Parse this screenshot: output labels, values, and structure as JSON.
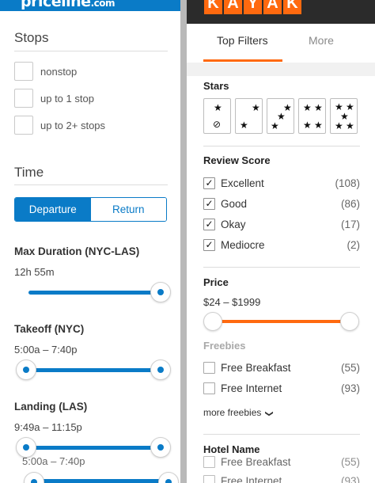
{
  "priceline": {
    "brand": "priceline",
    "brand_suffix": ".com",
    "stops": {
      "title": "Stops",
      "options": [
        "nonstop",
        "up to 1 stop",
        "up to 2+ stops"
      ]
    },
    "time": {
      "title": "Time",
      "toggle": {
        "departure": "Departure",
        "return": "Return"
      },
      "max_duration": {
        "label": "Max Duration (NYC-LAS)",
        "value": "12h 55m"
      },
      "takeoff": {
        "label": "Takeoff (NYC)",
        "value": "5:00a  –  7:40p"
      },
      "landing": {
        "label": "Landing (LAS)",
        "value": "9:49a  –  11:15p"
      },
      "ghost_value": "5:00a  –  7:40p"
    }
  },
  "kayak": {
    "logo_letters": [
      "K",
      "A",
      "Y",
      "A",
      "K"
    ],
    "tabs": {
      "top_filters": "Top Filters",
      "more": "More"
    },
    "stars": {
      "title": "Stars"
    },
    "review_score": {
      "title": "Review Score",
      "options": [
        {
          "label": "Excellent",
          "count": "(108)"
        },
        {
          "label": "Good",
          "count": "(86)"
        },
        {
          "label": "Okay",
          "count": "(17)"
        },
        {
          "label": "Mediocre",
          "count": "(2)"
        }
      ]
    },
    "price": {
      "title": "Price",
      "range": "$24 – $1999"
    },
    "freebies": {
      "title": "Freebies",
      "options": [
        {
          "label": "Free Breakfast",
          "count": "(55)"
        },
        {
          "label": "Free Internet",
          "count": "(93)"
        }
      ],
      "more_link": "more freebies"
    },
    "hotel_name": {
      "title": "Hotel Name"
    }
  },
  "colors": {
    "priceline_blue": "#0a7bc7",
    "kayak_orange": "#ff690f"
  }
}
